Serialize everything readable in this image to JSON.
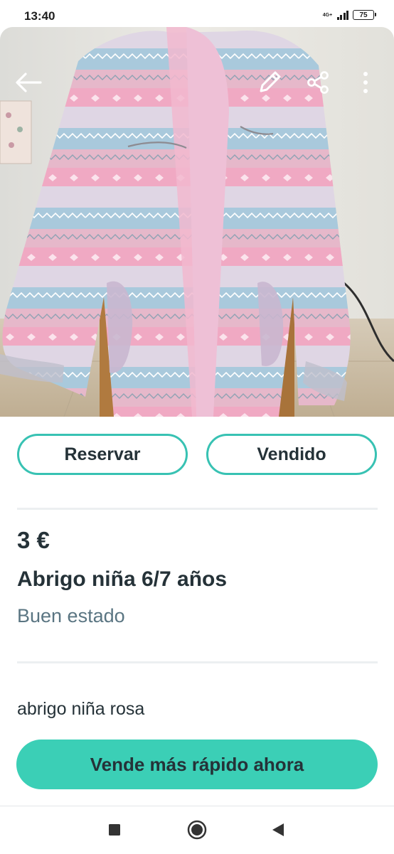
{
  "status_bar": {
    "time": "13:40",
    "network": "4G+",
    "battery": "75"
  },
  "header": {
    "icons": [
      "back-arrow-icon",
      "edit-pencil-icon",
      "share-icon",
      "more-vertical-icon"
    ]
  },
  "product": {
    "image_description_icon": "pink-and-blue-patterned-jacket-photo",
    "price": "3 €",
    "title": "Abrigo niña 6/7 años",
    "condition": "Buen estado",
    "description": "abrigo niña rosa"
  },
  "actions": {
    "reserve_label": "Reservar",
    "sold_label": "Vendido",
    "promote_label": "Vende más rápido ahora"
  },
  "system_nav": {
    "icons": [
      "recents-square-icon",
      "home-circle-icon",
      "back-triangle-icon"
    ]
  },
  "colors": {
    "accent": "#38c2b3",
    "primary_button": "#3bcfb6",
    "text": "#253238",
    "secondary_text": "#5a7582"
  }
}
